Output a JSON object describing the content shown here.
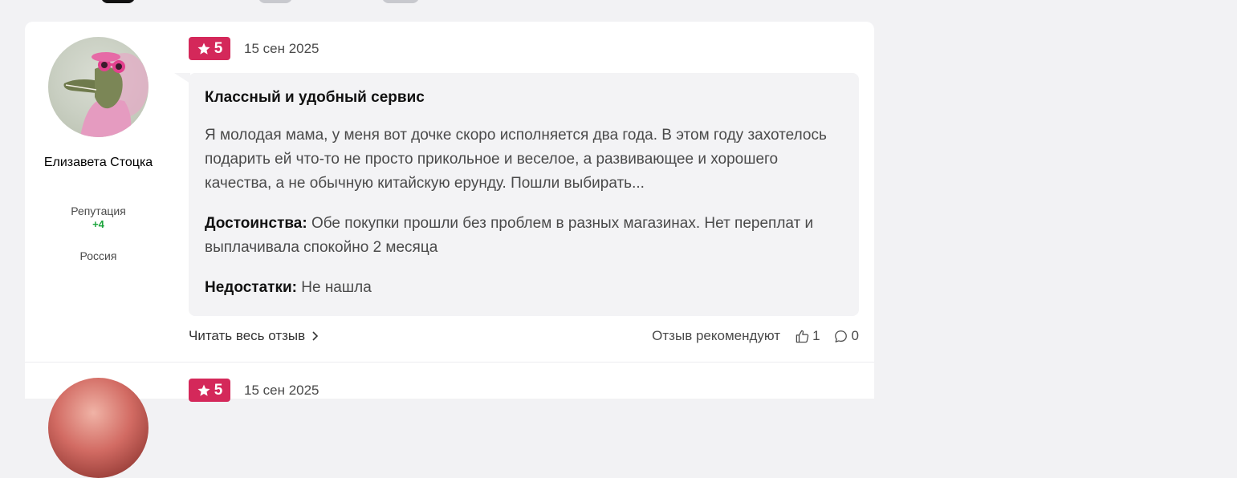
{
  "reviews": [
    {
      "author": {
        "name": "Елизавета Стоцка",
        "reputation_label": "Репутация",
        "reputation_value": "+4",
        "country": "Россия"
      },
      "rating": "5",
      "date": "15 сен 2025",
      "title": "Классный и удобный сервис",
      "text": "Я молодая мама, у меня вот дочке скоро исполняется два года. В этом году захотелось подарить ей что-то не просто прикольное и веселое, а развивающее и хорошего качества, а не обычную китайскую ерунду. Пошли выбирать...",
      "pros_label": "Достоинства:",
      "pros": "Обе покупки прошли без проблем в разных магазинах. Нет переплат и выплачивала спокойно 2 месяца",
      "cons_label": "Недостатки:",
      "cons": "Не нашла",
      "read_more": "Читать весь отзыв",
      "recommend_label": "Отзыв рекомендуют",
      "likes": "1",
      "comments": "0"
    },
    {
      "rating": "5",
      "date": "15 сен 2025"
    }
  ],
  "colors": {
    "accent": "#d4285a",
    "positive": "#1aa33a",
    "bubble": "#f3f3f5"
  },
  "icons": [
    "star-icon",
    "chevron-right-icon",
    "thumbs-up-icon",
    "comment-icon"
  ]
}
